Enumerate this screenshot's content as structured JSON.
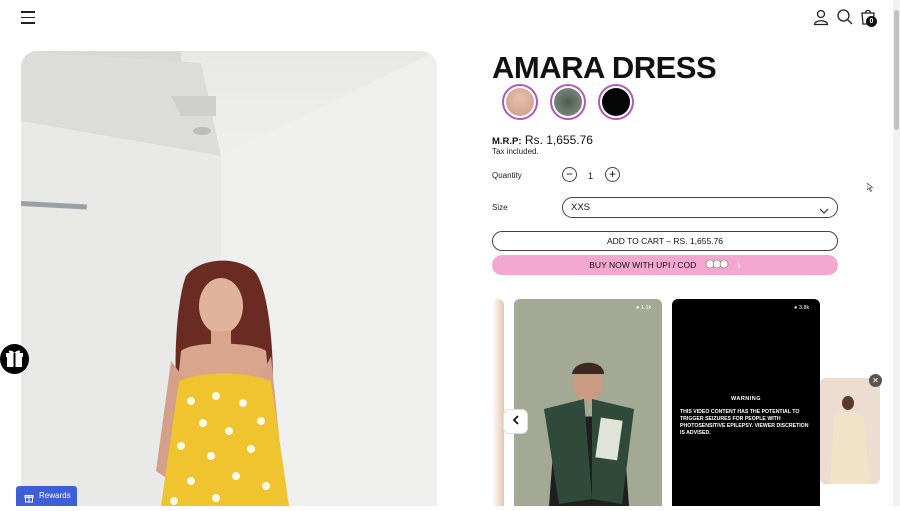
{
  "header": {
    "menu_icon": "hamburger-icon",
    "account_icon": "user-icon",
    "search_icon": "search-icon",
    "cart_icon": "bag-icon",
    "cart_count": "0"
  },
  "product": {
    "title": "AMARA DRESS",
    "mrp_label": "M.R.P:",
    "price": "Rs. 1,655.76",
    "tax_note": "Tax included.",
    "quantity_label": "Quantity",
    "quantity_value": "1",
    "size_label": "Size",
    "size_selected": "XXS",
    "add_to_cart_label": "ADD TO CART – RS. 1,655.76",
    "buy_now_label": "BUY NOW WITH UPI / COD",
    "accent_color": "#f5a8cf"
  },
  "reels": {
    "views": [
      "1.1k",
      "3.8k"
    ],
    "warning_title": "WARNING",
    "warning_text": "THIS VIDEO CONTENT HAS THE POTENTIAL TO TRIGGER SEIZURES FOR PEOPLE WITH PHOTOSENSITIVE EPILEPSY. VIEWER DISCRETION IS ADVISED."
  },
  "widgets": {
    "rewards_label": "Rewards",
    "rewards_color": "#3f5fd6"
  }
}
